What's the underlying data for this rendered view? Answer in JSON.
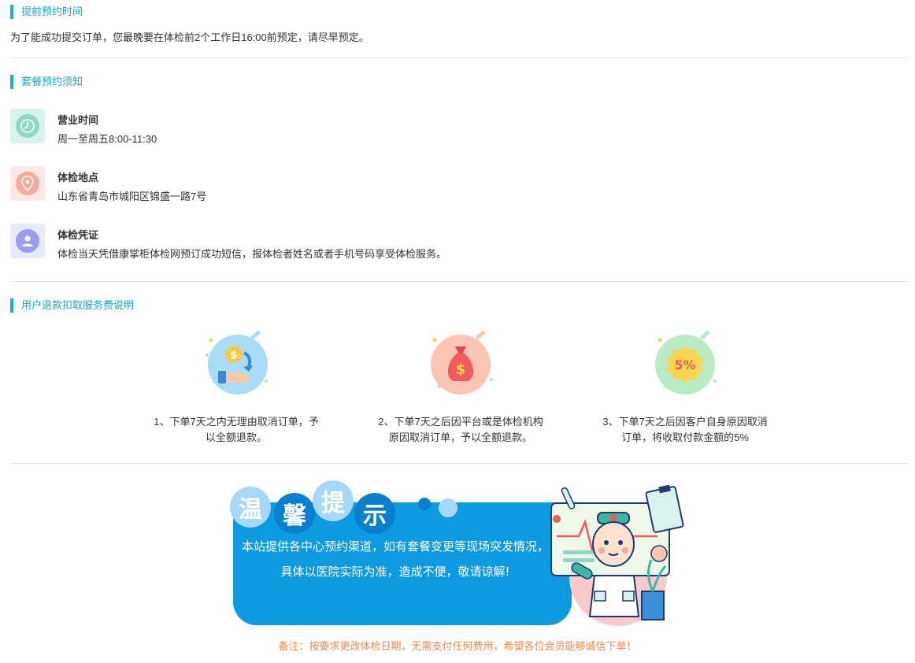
{
  "advance": {
    "title": "提前预约时间",
    "text": "为了能成功提交订单，您最晚要在体检前2个工作日16:00前预定，请尽早预定。"
  },
  "notice_section": {
    "title": "套餐预约须知",
    "items": [
      {
        "label": "营业时间",
        "value": "周一至周五8:00-11:30",
        "icon": "clock-icon",
        "bg": "#d8f3ee",
        "color": "#8fd8c8"
      },
      {
        "label": "体检地点",
        "value": "山东省青岛市城阳区锦盛一路7号",
        "icon": "location-pin-icon",
        "bg": "#fde9e4",
        "color": "#f7a99a"
      },
      {
        "label": "体检凭证",
        "value": "体检当天凭借康掌柜体检网预订成功短信，报体检者姓名或者手机号码享受体检服务。",
        "icon": "person-icon",
        "bg": "#e8eafb",
        "color": "#9a9ef0"
      }
    ]
  },
  "refund_section": {
    "title": "用户退款扣取服务费说明",
    "items": [
      {
        "text": "1、下单7天之内无理由取消订单，予以全额退款。",
        "icon": "coin-refund-icon",
        "color": "#9fd6f5"
      },
      {
        "text": "2、下单7天之后因平台或是体检机构原因取消订单，予以全额退款。",
        "icon": "money-bag-icon",
        "color": "#fcc2ae"
      },
      {
        "text": "3、下单7天之后因客户自身原因取消订单，将收取付款金额的5%",
        "icon": "percent-badge-icon",
        "color": "#b9ecc4"
      }
    ],
    "badge_text": "5%"
  },
  "warm_tip": {
    "chars": [
      "温",
      "馨",
      "提",
      "示"
    ],
    "message": "本站提供各中心预约渠道，如有套餐变更等现场突发情况，具体以医院实际为准，造成不便，敬请谅解!"
  },
  "footer": {
    "note": "备注：按要求更改体检日期，无需支付任何费用，希望各位会员能够诚信下单！"
  },
  "colors": {
    "accent": "#17a8bd",
    "panel_blue": "#0c9be0",
    "footer_orange": "#ef8b4c"
  }
}
